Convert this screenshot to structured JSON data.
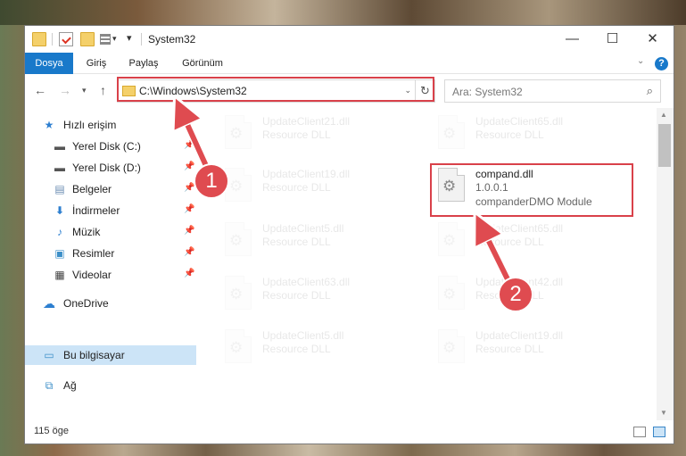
{
  "window": {
    "title": "System32"
  },
  "ribbon": {
    "tabs": [
      {
        "label": "Dosya"
      },
      {
        "label": "Giriş"
      },
      {
        "label": "Paylaş"
      },
      {
        "label": "Görünüm"
      }
    ]
  },
  "address": {
    "path": "C:\\Windows\\System32"
  },
  "search": {
    "placeholder": "Ara: System32"
  },
  "nav": {
    "quick_access": "Hızlı erişim",
    "items": [
      {
        "label": "Yerel Disk (C:)"
      },
      {
        "label": "Yerel Disk (D:)"
      },
      {
        "label": "Belgeler"
      },
      {
        "label": "İndirmeler"
      },
      {
        "label": "Müzik"
      },
      {
        "label": "Resimler"
      },
      {
        "label": "Videolar"
      }
    ],
    "onedrive": "OneDrive",
    "this_pc": "Bu bilgisayar",
    "network": "Ağ"
  },
  "files": [
    {
      "name": "UpdateClient21.dll",
      "desc": "Resource DLL"
    },
    {
      "name": "UpdateClient65.dll",
      "desc": "Resource DLL"
    },
    {
      "name": "UpdateClient19.dll",
      "desc": "Resource DLL"
    },
    {
      "name": "compand.dll",
      "version": "1.0.0.1",
      "desc": "companderDMO Module"
    },
    {
      "name": "UpdateClient5.dll",
      "desc": "Resource DLL"
    },
    {
      "name": "UpdateClient65.dll",
      "desc": "Resource DLL"
    },
    {
      "name": "UpdateClient63.dll",
      "desc": "Resource DLL"
    },
    {
      "name": "UpdateClient42.dll",
      "desc": "Resource DLL"
    },
    {
      "name": "UpdateClient5.dll",
      "desc": "Resource DLL"
    },
    {
      "name": "UpdateClient19.dll",
      "desc": "Resource DLL"
    }
  ],
  "status": {
    "count": "115 öge"
  },
  "annotations": {
    "step1": "1",
    "step2": "2"
  },
  "colors": {
    "accent": "#1979ca",
    "highlight": "#d9414a",
    "selection": "#cce4f7"
  }
}
